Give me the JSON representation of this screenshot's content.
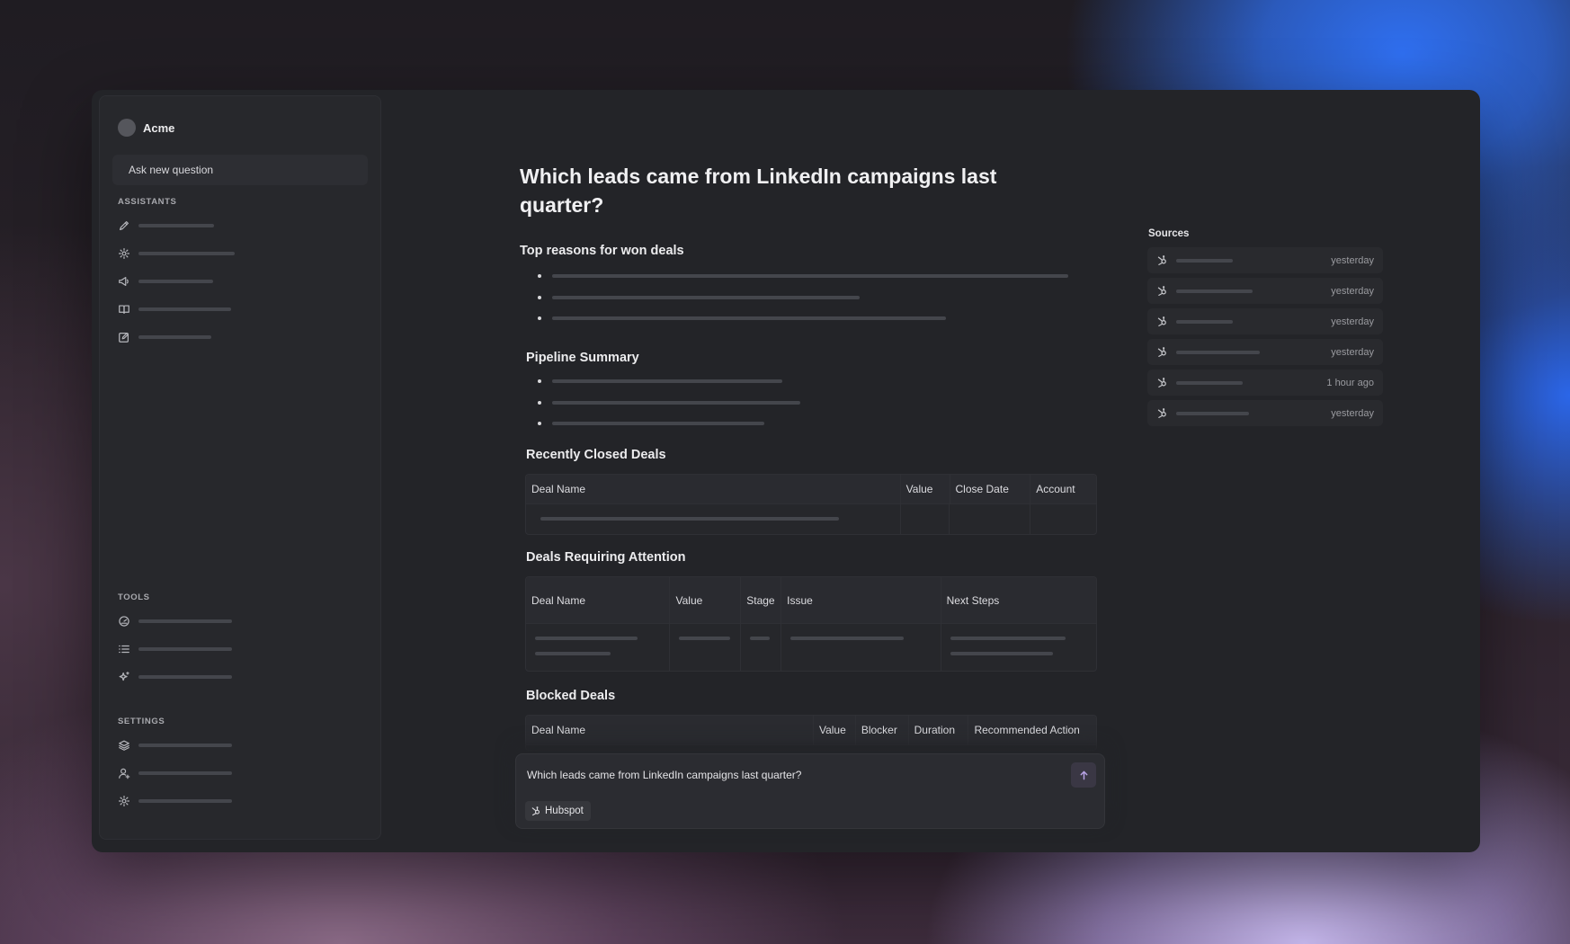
{
  "sidebar": {
    "brand": "Acme",
    "ask_new_question": "Ask new question",
    "assistants_label": "ASSISTANTS",
    "tools_label": "TOOLS",
    "settings_label": "SETTINGS",
    "assistant_icons": [
      "pen-icon",
      "gear-icon",
      "megaphone-icon",
      "book-icon",
      "edit-icon"
    ],
    "tool_icons": [
      "gauge-icon",
      "list-icon",
      "sparkle-icon"
    ],
    "settings_icons": [
      "layers-icon",
      "user-add-icon",
      "gear-icon"
    ]
  },
  "main": {
    "title": "Which leads came from LinkedIn campaigns last quarter?",
    "sections": {
      "won_reasons": "Top reasons for won deals",
      "pipeline": "Pipeline Summary",
      "recently_closed": "Recently Closed Deals",
      "attention": "Deals Requiring Attention",
      "blocked": "Blocked Deals"
    },
    "recently_closed_headers": [
      "Deal Name",
      "Value",
      "Close Date",
      "Account"
    ],
    "attention_headers": [
      "Deal Name",
      "Value",
      "Stage",
      "Issue",
      "Next Steps"
    ],
    "blocked_headers": [
      "Deal Name",
      "Value",
      "Blocker",
      "Duration",
      "Recommended Action"
    ]
  },
  "sources": {
    "label": "Sources",
    "items": [
      {
        "icon": "hubspot-icon",
        "time": "yesterday"
      },
      {
        "icon": "hubspot-icon",
        "time": "yesterday"
      },
      {
        "icon": "hubspot-icon",
        "time": "yesterday"
      },
      {
        "icon": "hubspot-icon",
        "time": "yesterday"
      },
      {
        "icon": "hubspot-icon",
        "time": "1 hour ago"
      },
      {
        "icon": "hubspot-icon",
        "time": "yesterday"
      }
    ]
  },
  "composer": {
    "text": "Which leads came from LinkedIn campaigns last quarter?",
    "chip_label": "Hubspot",
    "send_icon": "arrow-up-icon"
  }
}
